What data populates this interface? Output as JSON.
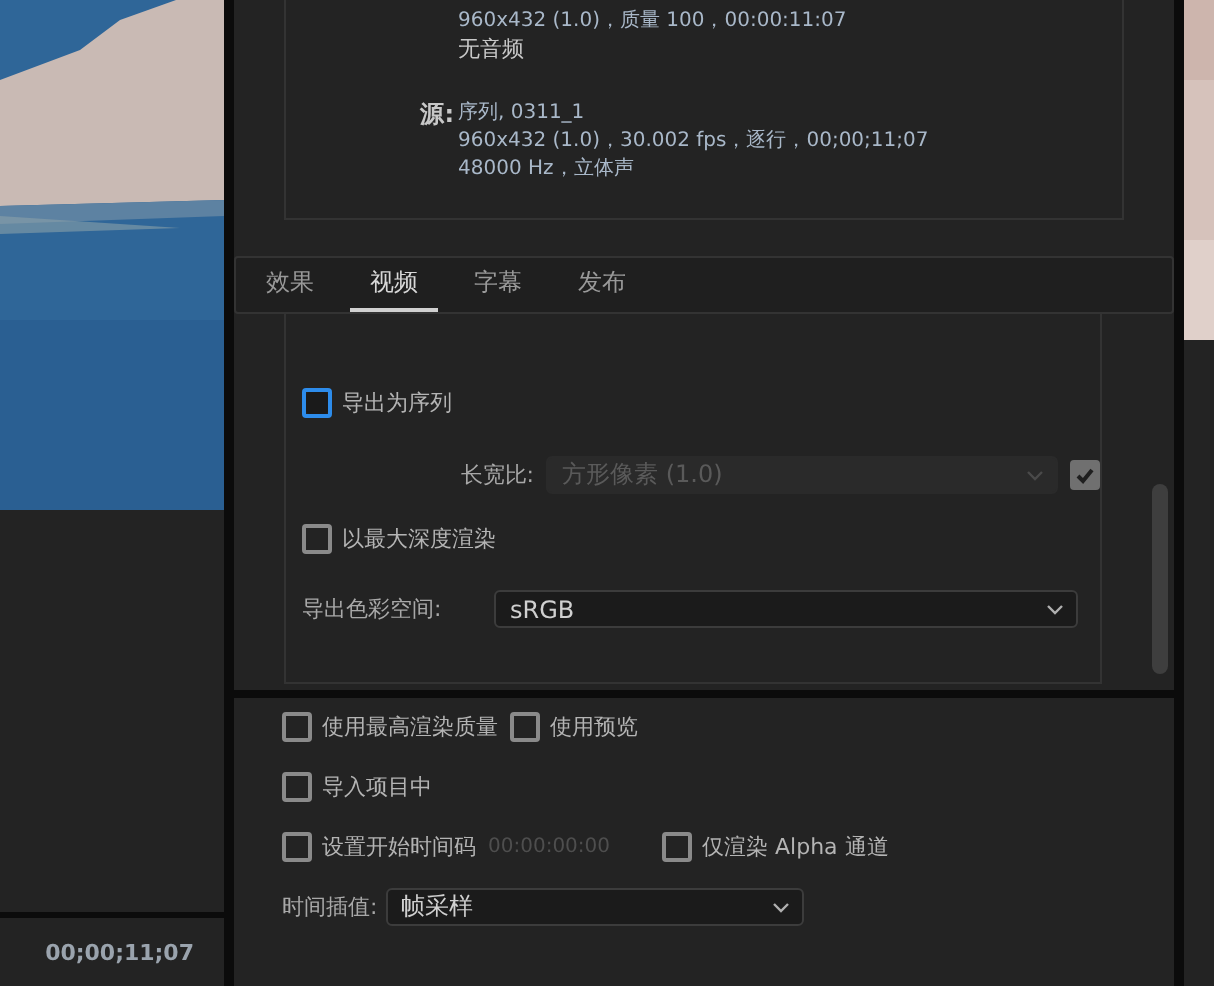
{
  "preview": {
    "timecode": "00;00;11;07"
  },
  "summary": {
    "output_lines": [
      "960x432 (1.0)，质量 100，00:00:11:07",
      "无音频"
    ],
    "source_label": "源:",
    "source_lines": [
      "序列, 0311_1",
      "960x432 (1.0)，30.002 fps，逐行，00;00;11;07",
      "48000 Hz，立体声"
    ]
  },
  "tabs": [
    {
      "label": "效果",
      "selected": false
    },
    {
      "label": "视频",
      "selected": true
    },
    {
      "label": "字幕",
      "selected": false
    },
    {
      "label": "发布",
      "selected": false
    }
  ],
  "video": {
    "export_as_sequence": {
      "label": "导出为序列",
      "checked": false,
      "focused": true
    },
    "aspect_ratio": {
      "label": "长宽比:",
      "value": "方形像素 (1.0)",
      "disabled": true,
      "checked": true
    },
    "max_depth": {
      "label": "以最大深度渲染",
      "checked": false
    },
    "color_space": {
      "label": "导出色彩空间:",
      "value": "sRGB"
    }
  },
  "options": [
    [
      {
        "kind": "checkbox",
        "label": "使用最高渲染质量",
        "checked": false
      },
      {
        "kind": "checkbox",
        "label": "使用预览",
        "checked": false
      }
    ],
    [
      {
        "kind": "checkbox",
        "label": "导入项目中",
        "checked": false
      }
    ],
    [
      {
        "kind": "checkbox",
        "label": "设置开始时间码",
        "checked": false
      },
      {
        "kind": "timecode",
        "value": "00:00:00:00",
        "disabled": true
      },
      {
        "kind": "checkbox",
        "label": "仅渲染 Alpha 通道",
        "checked": false
      }
    ]
  ],
  "time_interpolation": {
    "label": "时间插值:",
    "value": "帧采样"
  }
}
